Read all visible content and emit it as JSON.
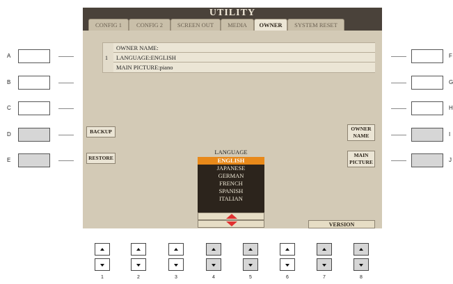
{
  "screen": {
    "title": "UTILITY",
    "tabs": [
      "CONFIG 1",
      "CONFIG 2",
      "SCREEN OUT",
      "MEDIA",
      "OWNER",
      "SYSTEM RESET"
    ],
    "active_tab": "OWNER"
  },
  "owner_info": {
    "row_index": "1",
    "owner_name": "OWNER NAME:",
    "language": "LANGUAGE:ENGLISH",
    "main_picture": "MAIN PICTURE:piano"
  },
  "buttons": {
    "backup": "BACKUP",
    "restore": "RESTORE",
    "owner_name_line1": "OWNER",
    "owner_name_line2": "NAME",
    "main_picture_line1": "MAIN",
    "main_picture_line2": "PICTURE",
    "version": "VERSION"
  },
  "language_panel": {
    "heading": "LANGUAGE",
    "options": [
      "ENGLISH",
      "JAPANESE",
      "GERMAN",
      "FRENCH",
      "SPANISH",
      "ITALIAN"
    ],
    "selected": "ENGLISH",
    "up_arrow_icon": "triangle-up-icon",
    "down_arrow_icon": "triangle-down-icon"
  },
  "side_buttons": {
    "left": [
      "A",
      "B",
      "C",
      "D",
      "E"
    ],
    "right": [
      "F",
      "G",
      "H",
      "I",
      "J"
    ]
  },
  "bottom_buttons": [
    "1",
    "2",
    "3",
    "4",
    "5",
    "6",
    "7",
    "8"
  ],
  "colors": {
    "screen_bg": "#d3cab6",
    "title_bar": "#4a423a",
    "selection": "#e8891a",
    "arrow": "#e03030"
  }
}
